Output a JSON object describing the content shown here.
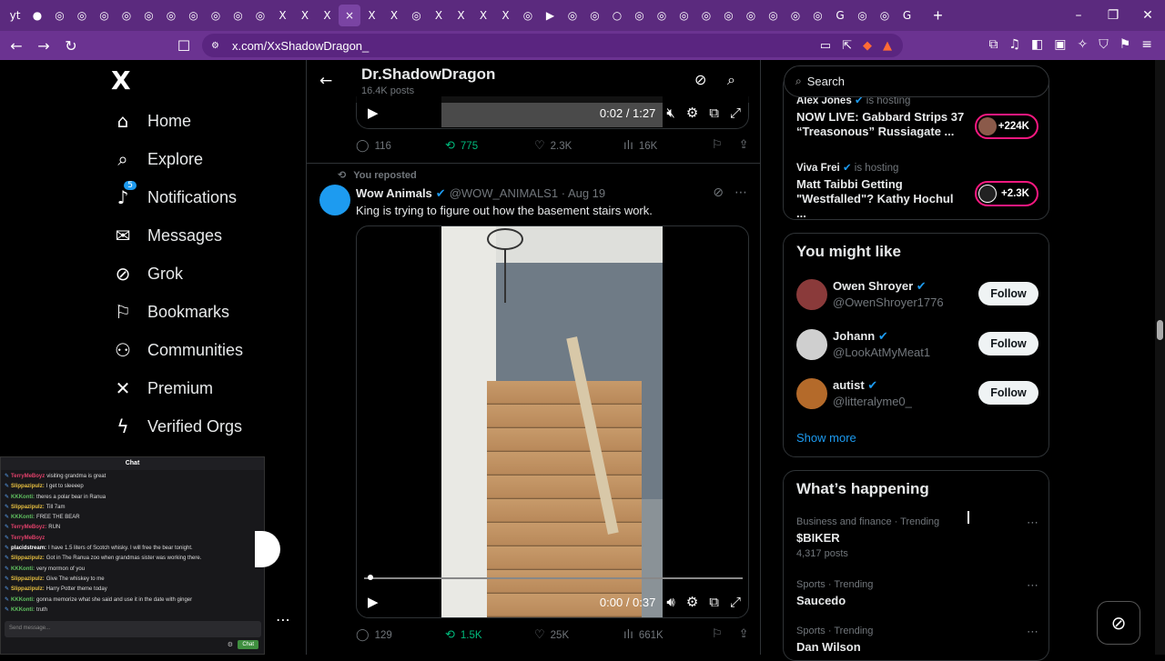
{
  "browser": {
    "tabs": [
      "yt",
      "●",
      "◎",
      "◎",
      "◎",
      "◎",
      "◎",
      "◎",
      "◎",
      "◎",
      "◎",
      "◎",
      "X",
      "X",
      "X",
      "×",
      "X",
      "X",
      "◎",
      "X",
      "X",
      "X",
      "X",
      "◎",
      "▶",
      "◎",
      "◎",
      "○",
      "◎",
      "◎",
      "◎",
      "◎",
      "◎",
      "◎",
      "◎",
      "◎",
      "◎",
      "G",
      "◎",
      "◎",
      "G"
    ],
    "new_tab": "+",
    "url": "x.com/XxShadowDragon_",
    "brave_badge": "1"
  },
  "nav": {
    "logo": "X",
    "items": [
      {
        "label": "Home",
        "icon": "home-icon"
      },
      {
        "label": "Explore",
        "icon": "search-icon"
      },
      {
        "label": "Notifications",
        "icon": "bell-icon",
        "badge": "5"
      },
      {
        "label": "Messages",
        "icon": "mail-icon"
      },
      {
        "label": "Grok",
        "icon": "grok-icon"
      },
      {
        "label": "Bookmarks",
        "icon": "bookmark-icon"
      },
      {
        "label": "Communities",
        "icon": "people-icon"
      },
      {
        "label": "Premium",
        "icon": "x-icon"
      },
      {
        "label": "Verified Orgs",
        "icon": "bolt-icon"
      }
    ]
  },
  "chat": {
    "title": "Chat",
    "lines": [
      {
        "user": "TerryMeBoyz",
        "color": "#e0406a",
        "text": "visiting grandma is great"
      },
      {
        "user": "Slippazipulz:",
        "color": "#e8c040",
        "text": "I get to sleeeep"
      },
      {
        "user": "KKKonti:",
        "color": "#60c060",
        "text": "theres a polar bear in Ranua"
      },
      {
        "user": "Slippazipulz:",
        "color": "#e8c040",
        "text": "Till 7am"
      },
      {
        "user": "KKKonti:",
        "color": "#60c060",
        "text": "FREE THE BEAR"
      },
      {
        "user": "TerryMeBoyz:",
        "color": "#e0406a",
        "text": "RUN"
      },
      {
        "user": "TerryMeBoyz",
        "color": "#e0406a",
        "text": ""
      },
      {
        "user": "placidstream:",
        "color": "#ffffff",
        "text": "I have 1.5 liters of Scotch whisky. I will free the bear tonight."
      },
      {
        "user": "Slippazipulz:",
        "color": "#e8c040",
        "text": "Got in The Ranua zoo when grandmas sister was working there."
      },
      {
        "user": "KKKonti:",
        "color": "#60c060",
        "text": "very mormon of you"
      },
      {
        "user": "Slippazipulz:",
        "color": "#e8c040",
        "text": "Give The whiskey to me"
      },
      {
        "user": "Slippazipulz:",
        "color": "#e8c040",
        "text": "Harry Potter theme today"
      },
      {
        "user": "KKKonti:",
        "color": "#60c060",
        "text": "gonna memorize what she said and use it in the date with ginger"
      },
      {
        "user": "KKKonti:",
        "color": "#60c060",
        "text": "truth"
      }
    ],
    "input_placeholder": "Send message...",
    "send_label": "Chat"
  },
  "profile": {
    "name": "Dr.ShadowDragon",
    "posts": "16.4K posts"
  },
  "tweet1": {
    "time": "0:02 / 1:27",
    "replies": "116",
    "reposts": "775",
    "likes": "2.3K",
    "views": "16K"
  },
  "tweet2": {
    "repost_note": "You reposted",
    "author": "Wow Animals",
    "handle": "@WOW_ANIMALS1",
    "date": "· Aug 19",
    "text": "King is trying to figure out how the basement stairs work.",
    "time": "0:00 / 0:37",
    "progress_fraction": 0.01,
    "replies": "129",
    "reposts": "1.5K",
    "likes": "25K",
    "views": "661K"
  },
  "right": {
    "search_placeholder": "Search",
    "spaces": [
      {
        "host": "Alex Jones",
        "status": "is hosting",
        "title": "NOW LIVE: Gabbard Strips 37 “Treasonous” Russiagate ...",
        "listeners": "+224K"
      },
      {
        "host": "Viva Frei",
        "status": "is hosting",
        "title": "Matt Taibbi Getting \"Westfalled\"? Kathy Hochul ...",
        "listeners": "+2.3K"
      }
    ],
    "wtf_title": "You might like",
    "wtf": [
      {
        "name": "Owen Shroyer",
        "handle": "@OwenShroyer1776",
        "follow": "Follow",
        "color": "#8a3a3a"
      },
      {
        "name": "Johann",
        "handle": "@LookAtMyMeat1",
        "follow": "Follow",
        "color": "#cfcfcf"
      },
      {
        "name": "autist",
        "handle": "@litteralyme0_",
        "follow": "Follow",
        "color": "#b46a2a"
      }
    ],
    "show_more": "Show more",
    "trends_title": "What’s happening",
    "trends": [
      {
        "context": "Business and finance · Trending",
        "title": "$BIKER",
        "count": "4,317 posts"
      },
      {
        "context": "Sports · Trending",
        "title": "Saucedo",
        "count": ""
      },
      {
        "context": "Sports · Trending",
        "title": "Dan Wilson",
        "count": ""
      }
    ]
  }
}
